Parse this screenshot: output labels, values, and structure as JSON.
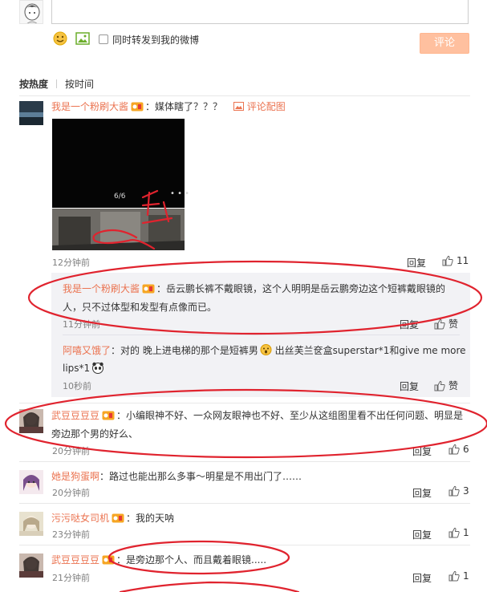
{
  "composer": {
    "repost_label": "同时转发到我的微博",
    "submit_label": "评论"
  },
  "sort": {
    "hot": "按热度",
    "time": "按时间"
  },
  "comments": [
    {
      "user": "我是一个粉刷大酱",
      "text": "：媒体瞎了？？？",
      "pic_label": "评论配图",
      "image_page": "6/6",
      "time": "12分钟前",
      "reply": "回复",
      "likes": "11",
      "replies": [
        {
          "user": "我是一个粉刷大酱",
          "text1": "：岳云鹏长裤不戴眼镜，这个人明明是岳云鹏旁边这个短裤戴眼镜的",
          "text2": "人，只不过体型和发型有点像而已。",
          "time": "11分钟前",
          "reply": "回复",
          "like": "赞"
        },
        {
          "user": "阿嘻又饿了",
          "text1": "：对的 晚上进电梯的那个是短裤男",
          "text1b": " 出丝芙兰奁盒superstar*1和give me more",
          "text2": "lips*1",
          "time": "10秒前",
          "reply": "回复",
          "like": "赞"
        }
      ]
    },
    {
      "user": "武豆豆豆豆",
      "text1": "：小编眼神不好、一众网友眼神也不好、至少从这组图里看不出任何问题、明显是",
      "text2": "旁边那个男的好么、",
      "time": "20分钟前",
      "reply": "回复",
      "likes": "6"
    },
    {
      "user": "她是狗蛋啊",
      "text": "：路过也能出那么多事～明星是不用出门了……",
      "time": "20分钟前",
      "reply": "回复",
      "likes": "3"
    },
    {
      "user": "污污哒女司机",
      "text": "：我的天呐",
      "time": "23分钟前",
      "reply": "回复",
      "likes": "1"
    },
    {
      "user": "武豆豆豆豆",
      "text": "：是旁边那个人、而且戴着眼镜.....",
      "time": "21分钟前",
      "reply": "回复",
      "likes": "1"
    }
  ],
  "colors": {
    "link": "#eb7350",
    "annotation": "#e0232e",
    "submit_bg": "#ffc09f"
  }
}
